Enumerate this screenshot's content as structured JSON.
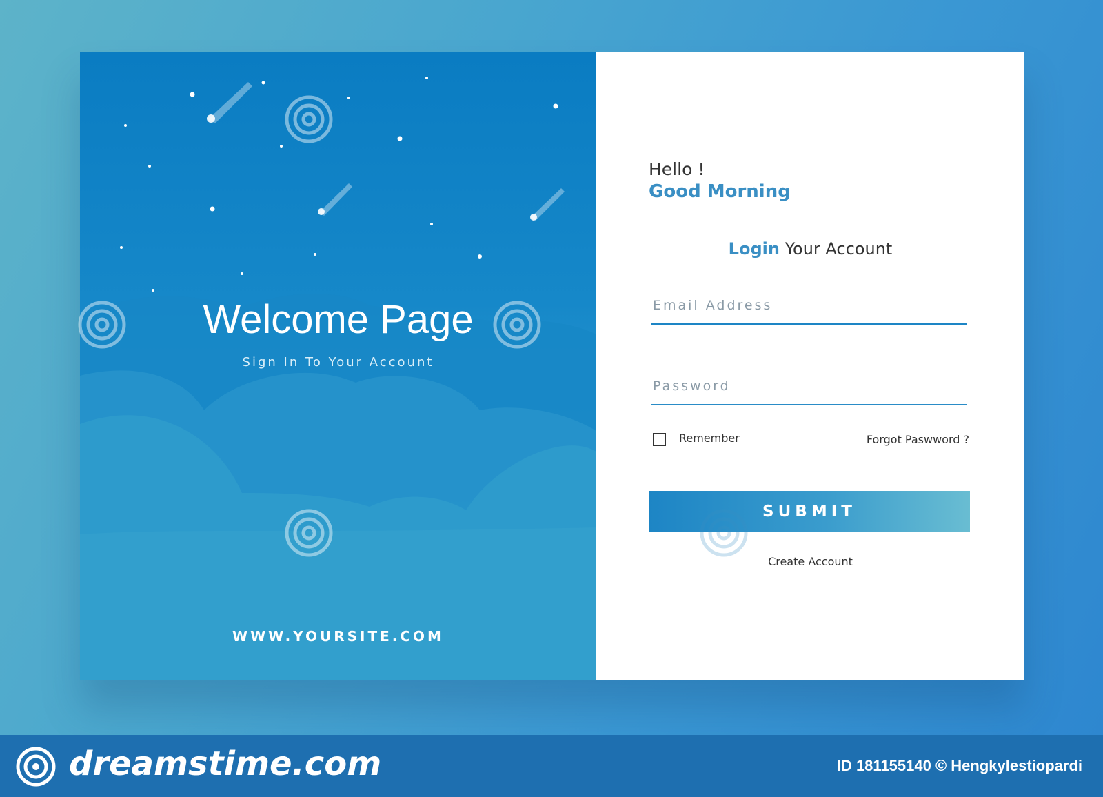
{
  "left_panel": {
    "title": "Welcome Page",
    "subtitle": "Sign In To Your Account",
    "site": "WWW.YOURSITE.COM"
  },
  "right_panel": {
    "greeting": "Hello !",
    "greeting_strong": "Good Morning",
    "login_accent": "Login",
    "login_rest": " Your Account",
    "email_placeholder": "Email Address",
    "password_placeholder": "Password",
    "remember_label": "Remember",
    "forgot_label": "Forgot Paswword ?",
    "submit_label": "SUBMIT",
    "create_label": "Create Account"
  },
  "watermark": {
    "brand": "dreamstime.com",
    "id_text": "ID 181155140 © Hengkylestiopardi",
    "overlay_text": "dreamstime"
  },
  "colors": {
    "accent": "#3a8fc4",
    "field_line": "#1d85c5",
    "footer": "#1e6fb0"
  }
}
